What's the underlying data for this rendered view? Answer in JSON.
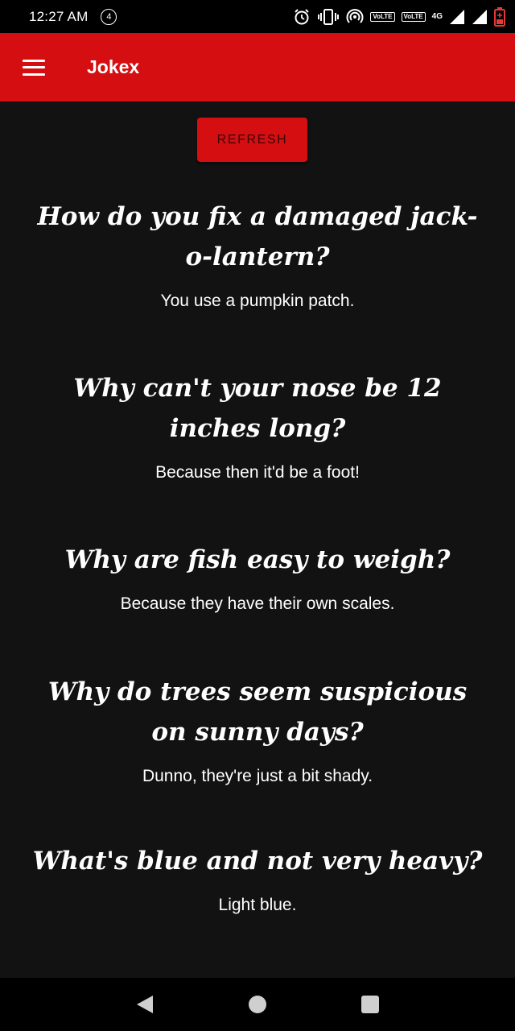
{
  "status_bar": {
    "time": "12:27 AM",
    "notification_count": "4",
    "volte1": "VoLTE",
    "volte2": "VoLTE",
    "network": "4G",
    "icons": [
      "alarm-icon",
      "vibrate-icon",
      "hotspot-icon",
      "signal-icon",
      "battery-icon"
    ]
  },
  "app_bar": {
    "title": "Jokex",
    "color": "#d50f11"
  },
  "refresh_label": "REFRESH",
  "jokes": [
    {
      "question": "How do you fix a damaged jack-o-lantern?",
      "answer": "You use a pumpkin patch."
    },
    {
      "question": "Why can't your nose be 12 inches long?",
      "answer": "Because then it'd be a foot!"
    },
    {
      "question": "Why are fish easy to weigh?",
      "answer": "Because they have their own scales."
    },
    {
      "question": "Why do trees seem suspicious on sunny days?",
      "answer": "Dunno, they're just a bit shady."
    },
    {
      "question": "What's blue and not very heavy?",
      "answer": "Light blue."
    }
  ],
  "nav": [
    "back-icon",
    "home-icon",
    "recents-icon"
  ]
}
